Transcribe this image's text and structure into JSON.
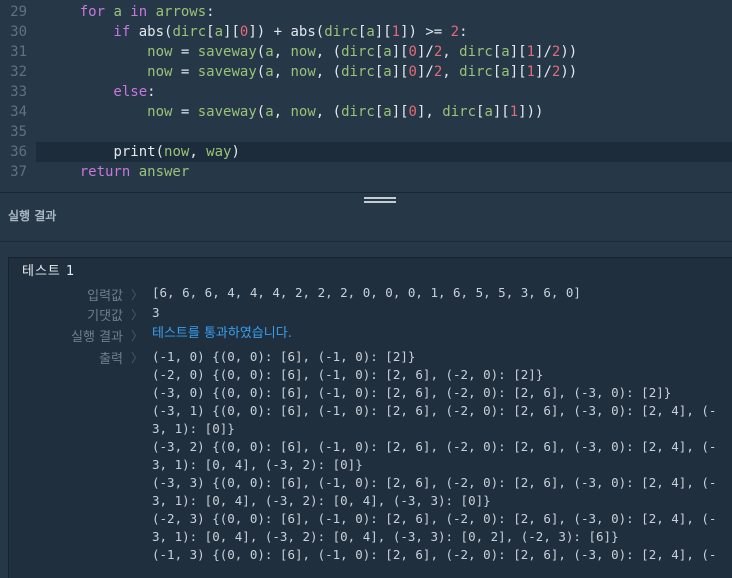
{
  "editor": {
    "lines": [
      {
        "num": "29",
        "parts": [
          [
            "kw",
            "    for "
          ],
          [
            "var",
            "a"
          ],
          [
            "kw",
            " in "
          ],
          [
            "var",
            "arrows"
          ],
          [
            "op",
            ":"
          ]
        ]
      },
      {
        "num": "30",
        "parts": [
          [
            "kw",
            "        if "
          ],
          [
            "fn",
            "abs("
          ],
          [
            "var",
            "dirc"
          ],
          [
            "op",
            "["
          ],
          [
            "var",
            "a"
          ],
          [
            "op",
            "]["
          ],
          [
            "num",
            "0"
          ],
          [
            "op",
            "]) + "
          ],
          [
            "fn",
            "abs("
          ],
          [
            "var",
            "dirc"
          ],
          [
            "op",
            "["
          ],
          [
            "var",
            "a"
          ],
          [
            "op",
            "]["
          ],
          [
            "num",
            "1"
          ],
          [
            "op",
            "]) >= "
          ],
          [
            "num",
            "2"
          ],
          [
            "op",
            ":"
          ]
        ]
      },
      {
        "num": "31",
        "parts": [
          [
            "op",
            "            "
          ],
          [
            "var",
            "now"
          ],
          [
            "op",
            " = "
          ],
          [
            "var",
            "saveway"
          ],
          [
            "op",
            "("
          ],
          [
            "var",
            "a"
          ],
          [
            "op",
            ", "
          ],
          [
            "var",
            "now"
          ],
          [
            "op",
            ", ("
          ],
          [
            "var",
            "dirc"
          ],
          [
            "op",
            "["
          ],
          [
            "var",
            "a"
          ],
          [
            "op",
            "]["
          ],
          [
            "num",
            "0"
          ],
          [
            "op",
            "]/"
          ],
          [
            "num",
            "2"
          ],
          [
            "op",
            ", "
          ],
          [
            "var",
            "dirc"
          ],
          [
            "op",
            "["
          ],
          [
            "var",
            "a"
          ],
          [
            "op",
            "]["
          ],
          [
            "num",
            "1"
          ],
          [
            "op",
            "]/"
          ],
          [
            "num",
            "2"
          ],
          [
            "op",
            "))"
          ]
        ]
      },
      {
        "num": "32",
        "parts": [
          [
            "op",
            "            "
          ],
          [
            "var",
            "now"
          ],
          [
            "op",
            " = "
          ],
          [
            "var",
            "saveway"
          ],
          [
            "op",
            "("
          ],
          [
            "var",
            "a"
          ],
          [
            "op",
            ", "
          ],
          [
            "var",
            "now"
          ],
          [
            "op",
            ", ("
          ],
          [
            "var",
            "dirc"
          ],
          [
            "op",
            "["
          ],
          [
            "var",
            "a"
          ],
          [
            "op",
            "]["
          ],
          [
            "num",
            "0"
          ],
          [
            "op",
            "]/"
          ],
          [
            "num",
            "2"
          ],
          [
            "op",
            ", "
          ],
          [
            "var",
            "dirc"
          ],
          [
            "op",
            "["
          ],
          [
            "var",
            "a"
          ],
          [
            "op",
            "]["
          ],
          [
            "num",
            "1"
          ],
          [
            "op",
            "]/"
          ],
          [
            "num",
            "2"
          ],
          [
            "op",
            "))"
          ]
        ]
      },
      {
        "num": "33",
        "parts": [
          [
            "kw",
            "        else"
          ],
          [
            "op",
            ":"
          ]
        ]
      },
      {
        "num": "34",
        "parts": [
          [
            "op",
            "            "
          ],
          [
            "var",
            "now"
          ],
          [
            "op",
            " = "
          ],
          [
            "var",
            "saveway"
          ],
          [
            "op",
            "("
          ],
          [
            "var",
            "a"
          ],
          [
            "op",
            ", "
          ],
          [
            "var",
            "now"
          ],
          [
            "op",
            ", ("
          ],
          [
            "var",
            "dirc"
          ],
          [
            "op",
            "["
          ],
          [
            "var",
            "a"
          ],
          [
            "op",
            "]["
          ],
          [
            "num",
            "0"
          ],
          [
            "op",
            "], "
          ],
          [
            "var",
            "dirc"
          ],
          [
            "op",
            "["
          ],
          [
            "var",
            "a"
          ],
          [
            "op",
            "]["
          ],
          [
            "num",
            "1"
          ],
          [
            "op",
            "]))"
          ]
        ]
      },
      {
        "num": "35",
        "parts": []
      },
      {
        "num": "36",
        "parts": [
          [
            "op",
            "        "
          ],
          [
            "fn",
            "print("
          ],
          [
            "var",
            "now"
          ],
          [
            "op",
            ", "
          ],
          [
            "var",
            "way"
          ],
          [
            "op",
            ")"
          ]
        ],
        "active": true
      },
      {
        "num": "37",
        "parts": [
          [
            "kw",
            "    return "
          ],
          [
            "var",
            "answer"
          ]
        ]
      }
    ]
  },
  "result": {
    "header_title": "실행 결과",
    "test_title": "테스트 1",
    "input_label": "입력값",
    "input_value": "[6, 6, 6, 4, 4, 4, 2, 2, 2, 0, 0, 0, 1, 6, 5, 5, 3, 6, 0]",
    "expected_label": "기댓값",
    "expected_value": "3",
    "result_label": "실행 결과",
    "result_value": "테스트를 통과하였습니다.",
    "output_label": "출력",
    "separator": "〉",
    "output_lines": [
      "(-1, 0) {(0, 0): [6], (-1, 0): [2]}",
      "(-2, 0) {(0, 0): [6], (-1, 0): [2, 6], (-2, 0): [2]}",
      "(-3, 0) {(0, 0): [6], (-1, 0): [2, 6], (-2, 0): [2, 6], (-3, 0): [2]}",
      "(-3, 1) {(0, 0): [6], (-1, 0): [2, 6], (-2, 0): [2, 6], (-3, 0): [2, 4], (-",
      "3, 1): [0]}",
      "(-3, 2) {(0, 0): [6], (-1, 0): [2, 6], (-2, 0): [2, 6], (-3, 0): [2, 4], (-",
      "3, 1): [0, 4], (-3, 2): [0]}",
      "(-3, 3) {(0, 0): [6], (-1, 0): [2, 6], (-2, 0): [2, 6], (-3, 0): [2, 4], (-",
      "3, 1): [0, 4], (-3, 2): [0, 4], (-3, 3): [0]}",
      "(-2, 3) {(0, 0): [6], (-1, 0): [2, 6], (-2, 0): [2, 6], (-3, 0): [2, 4], (-",
      "3, 1): [0, 4], (-3, 2): [0, 4], (-3, 3): [0, 2], (-2, 3): [6]}",
      "(-1, 3) {(0, 0): [6], (-1, 0): [2, 6], (-2, 0): [2, 6], (-3, 0): [2, 4], (-"
    ]
  }
}
